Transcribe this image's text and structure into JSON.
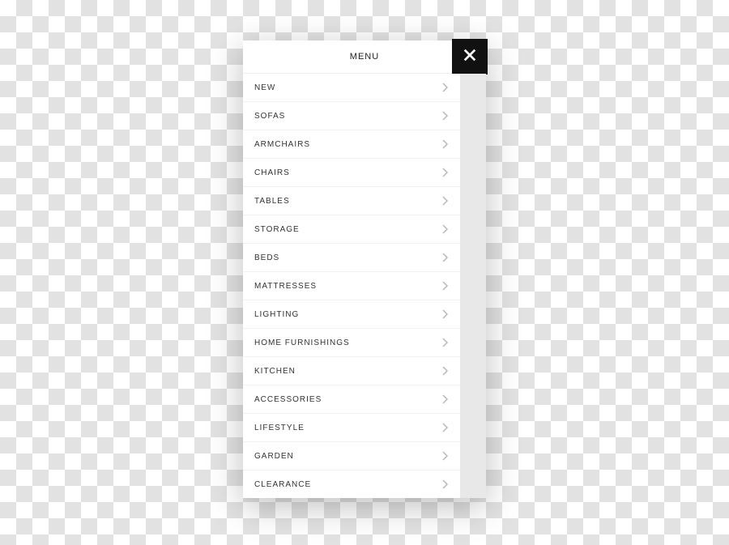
{
  "menu": {
    "title": "MENU",
    "items": [
      {
        "label": "NEW"
      },
      {
        "label": "SOFAS"
      },
      {
        "label": "ARMCHAIRS"
      },
      {
        "label": "CHAIRS"
      },
      {
        "label": "TABLES"
      },
      {
        "label": "STORAGE"
      },
      {
        "label": "BEDS"
      },
      {
        "label": "MATTRESSES"
      },
      {
        "label": "LIGHTING"
      },
      {
        "label": "HOME FURNISHINGS"
      },
      {
        "label": "KITCHEN"
      },
      {
        "label": "ACCESSORIES"
      },
      {
        "label": "LIFESTYLE"
      },
      {
        "label": "GARDEN"
      },
      {
        "label": "CLEARANCE"
      }
    ]
  }
}
